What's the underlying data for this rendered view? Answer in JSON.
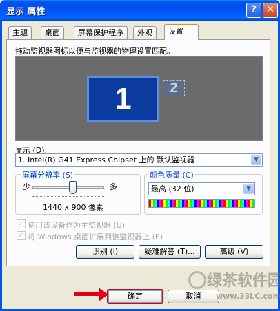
{
  "window": {
    "title": "显示 属性",
    "help_label": "?",
    "close_label": "✕"
  },
  "tabs": [
    "主题",
    "桌面",
    "屏幕保护程序",
    "外观",
    "设置"
  ],
  "settings": {
    "instruction": "拖动监视器图标以便与监视器的物理设置匹配。",
    "monitor_1": "1",
    "monitor_2": "2",
    "display_label": "显示 (D):",
    "display_value": "1. Intel(R) G41 Express Chipset 上的 默认监视器",
    "resolution": {
      "legend": "屏幕分辨率 (S)",
      "min_label": "少",
      "max_label": "多",
      "value": "1440 x 900 像素"
    },
    "color_quality": {
      "legend": "颜色质量 (C)",
      "value": "最高 (32 位)"
    },
    "checkbox_primary": "使用该设备作为主监视器 (U)",
    "checkbox_extend": "将 Windows 桌面扩展到该监视器上 (E)",
    "buttons": {
      "identify": "识别 (I)",
      "troubleshoot": "疑难解答 (T)...",
      "advanced": "高级 (V)"
    }
  },
  "footer": {
    "ok": "确定",
    "cancel": "取消"
  },
  "watermark": {
    "text": "绿茶软件园",
    "url": "www.33LC.com"
  }
}
